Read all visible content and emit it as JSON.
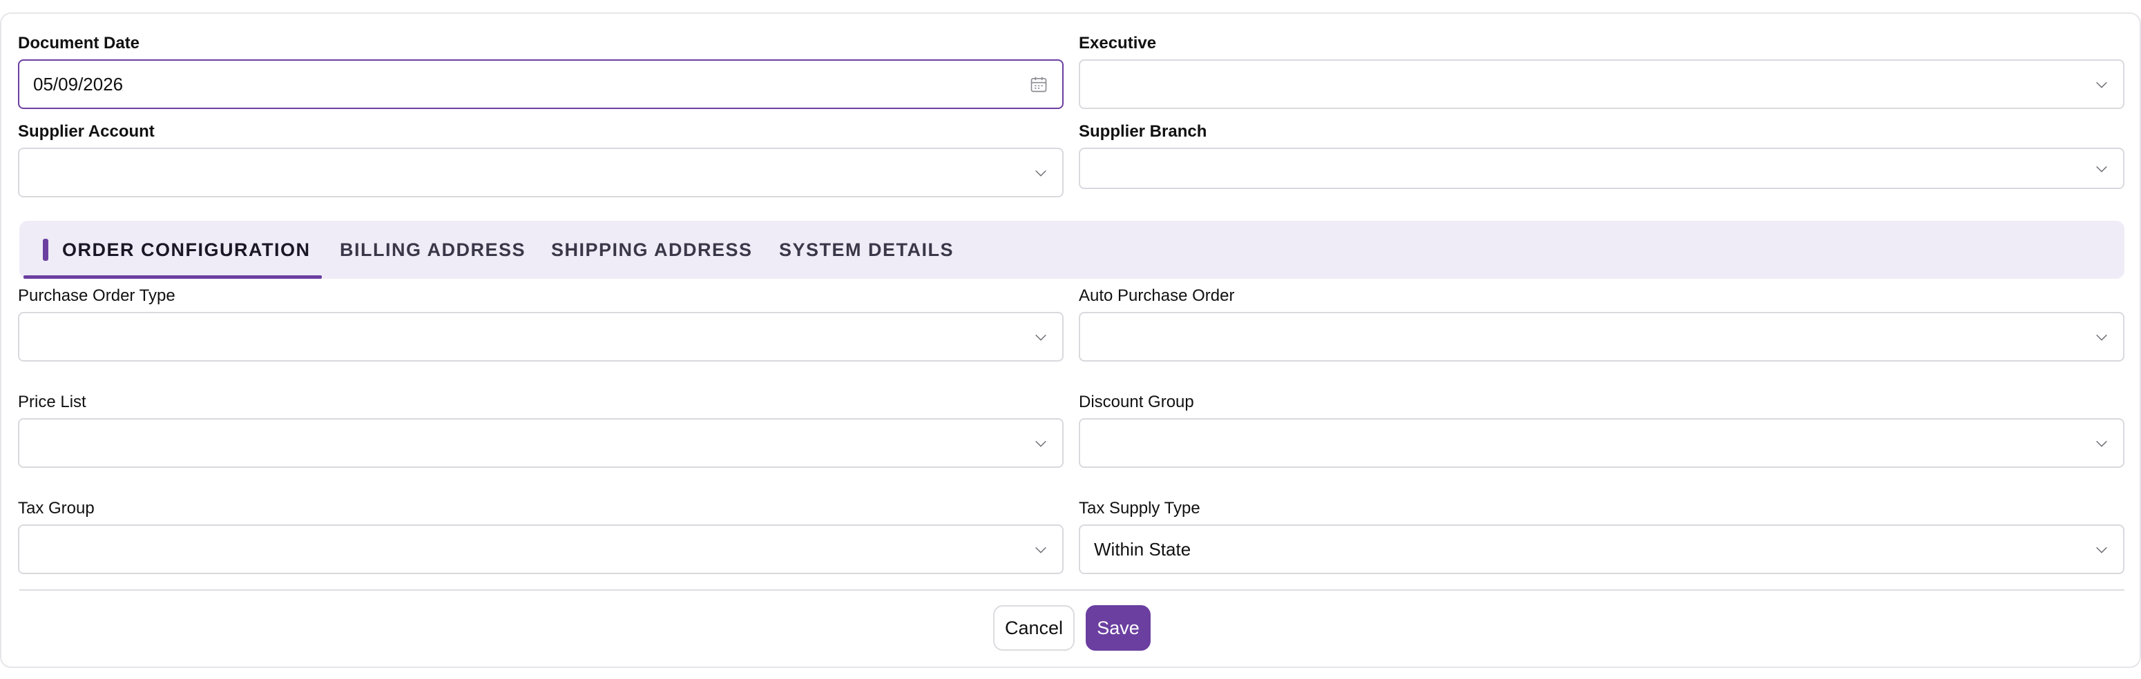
{
  "header_fields": {
    "document_date": {
      "label": "Document Date",
      "value": "05/09/2026"
    },
    "executive": {
      "label": "Executive",
      "value": ""
    },
    "supplier_account": {
      "label": "Supplier Account",
      "value": ""
    },
    "supplier_branch": {
      "label": "Supplier Branch",
      "value": ""
    }
  },
  "tabs": [
    {
      "label": "ORDER CONFIGURATION",
      "active": true
    },
    {
      "label": "BILLING ADDRESS",
      "active": false
    },
    {
      "label": "SHIPPING ADDRESS",
      "active": false
    },
    {
      "label": "SYSTEM DETAILS",
      "active": false
    }
  ],
  "order_config": {
    "purchase_order_type": {
      "label": "Purchase Order Type",
      "value": ""
    },
    "auto_purchase_order": {
      "label": "Auto Purchase Order",
      "value": ""
    },
    "price_list": {
      "label": "Price List",
      "value": ""
    },
    "discount_group": {
      "label": "Discount Group",
      "value": ""
    },
    "tax_group": {
      "label": "Tax Group",
      "value": ""
    },
    "tax_supply_type": {
      "label": "Tax Supply Type",
      "value": "Within State"
    }
  },
  "actions": {
    "cancel_label": "Cancel",
    "save_label": "Save"
  },
  "colors": {
    "accent": "#6b3fa0",
    "tab_background": "#efecf7",
    "border": "#d9d9de"
  },
  "icons": {
    "date_picker": "calendar-icon",
    "dropdown": "chevron-down-icon"
  }
}
